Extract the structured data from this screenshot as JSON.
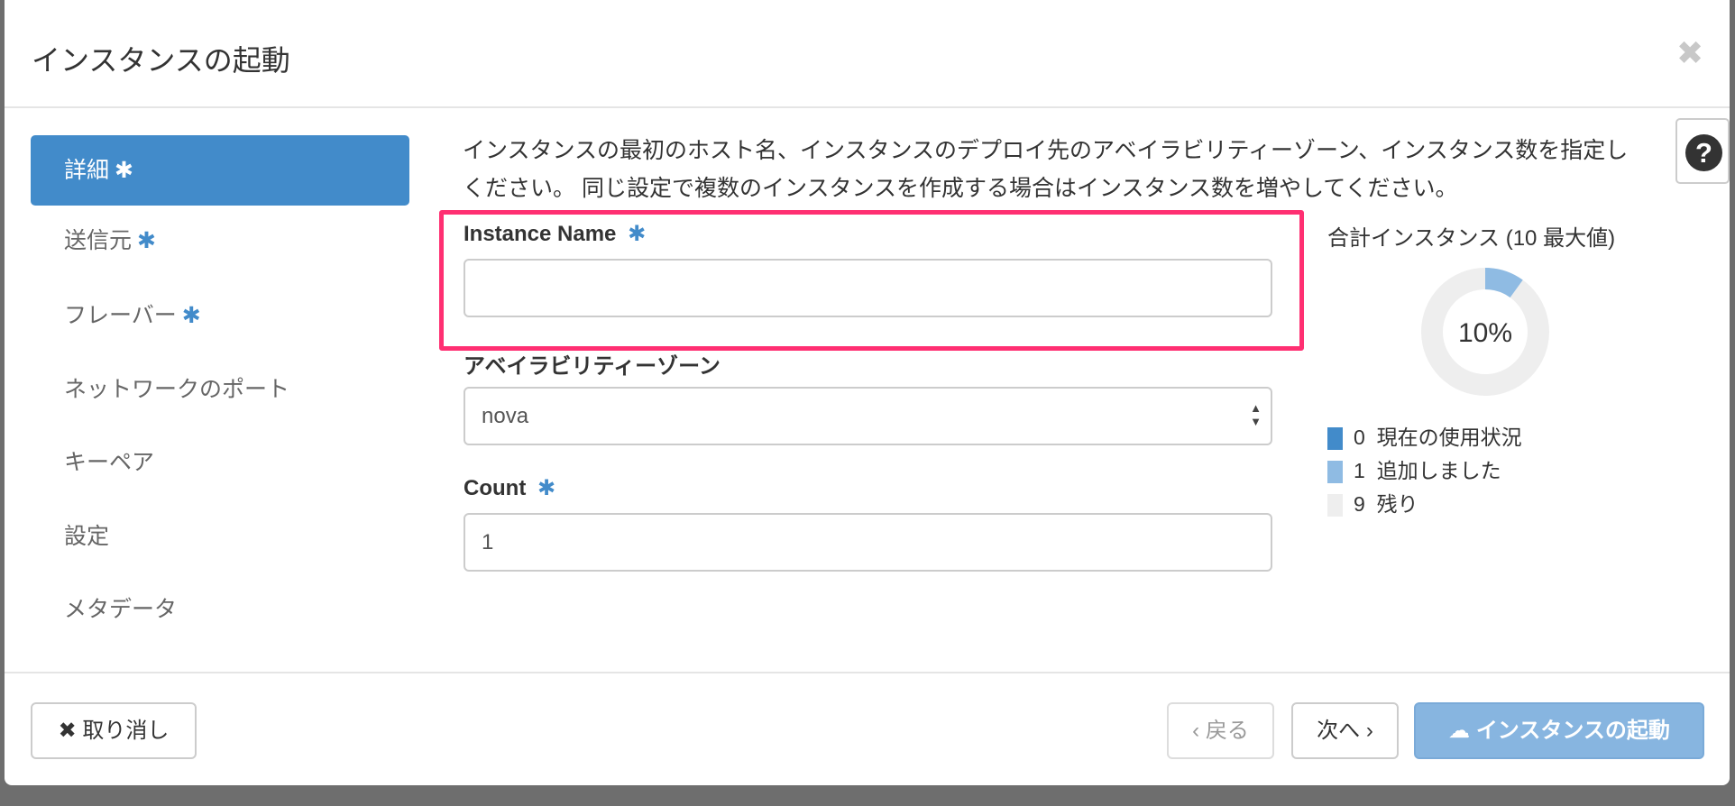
{
  "dialog": {
    "title": "インスタンスの起動",
    "close_icon": "close-icon"
  },
  "sidebar": {
    "items": [
      {
        "label": "詳細",
        "required": "✱"
      },
      {
        "label": "送信元",
        "required": "✱"
      },
      {
        "label": "フレーバー",
        "required": "✱"
      },
      {
        "label": "ネットワークのポート"
      },
      {
        "label": "キーペア"
      },
      {
        "label": "設定"
      },
      {
        "label": "メタデータ"
      }
    ]
  },
  "main": {
    "description_line1": "インスタンスの最初のホスト名、インスタンスのデプロイ先のアベイラビリティーゾーン、インスタンス数を指定し",
    "description_line2": "ください。 同じ設定で複数のインスタンスを作成する場合はインスタンス数を増やしてください。",
    "instance_name_label": "Instance Name",
    "required": "✱",
    "instance_name_value": "",
    "az_label": "アベイラビリティーゾーン",
    "az_value": "nova",
    "count_label": "Count",
    "count_value": "1",
    "help": "?"
  },
  "quota": {
    "title": "合計インスタンス (10 最大値)",
    "percent_label": "10%",
    "max": 10,
    "legend": [
      {
        "value": "0",
        "label": "現在の使用状況",
        "color": "#428bca"
      },
      {
        "value": "1",
        "label": "追加しました",
        "color": "#8fbbe3"
      },
      {
        "value": "9",
        "label": "残り",
        "color": "#eeeeee"
      }
    ]
  },
  "footer": {
    "cancel": "取り消し",
    "back": "‹ 戻る",
    "next": "次へ ›",
    "launch": "インスタンスの起動"
  }
}
